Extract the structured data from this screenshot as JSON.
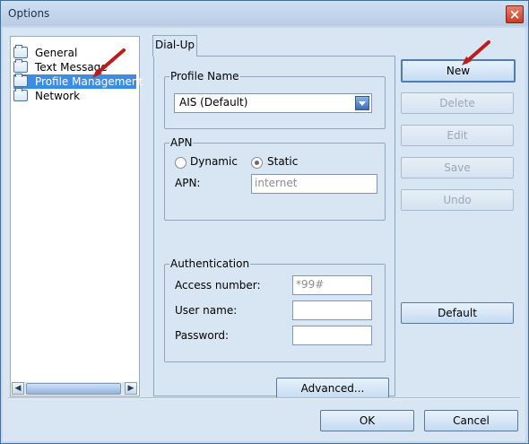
{
  "window": {
    "title": "Options"
  },
  "tree": {
    "items": [
      "General",
      "Text Message",
      "Profile Management",
      "Network"
    ]
  },
  "tab": {
    "label": "Dial-Up"
  },
  "profile": {
    "legend": "Profile Name",
    "selected": "AIS (Default)"
  },
  "apn": {
    "legend": "APN",
    "dynamic_label": "Dynamic",
    "static_label": "Static",
    "apn_label": "APN:",
    "apn_value": "internet"
  },
  "auth": {
    "legend": "Authentication",
    "access_label": "Access number:",
    "access_value": "*99#",
    "user_label": "User name:",
    "user_value": "",
    "password_label": "Password:",
    "password_value": ""
  },
  "buttons": {
    "new": "New",
    "delete": "Delete",
    "edit": "Edit",
    "save": "Save",
    "undo": "Undo",
    "default": "Default",
    "advanced": "Advanced...",
    "ok": "OK",
    "cancel": "Cancel"
  }
}
